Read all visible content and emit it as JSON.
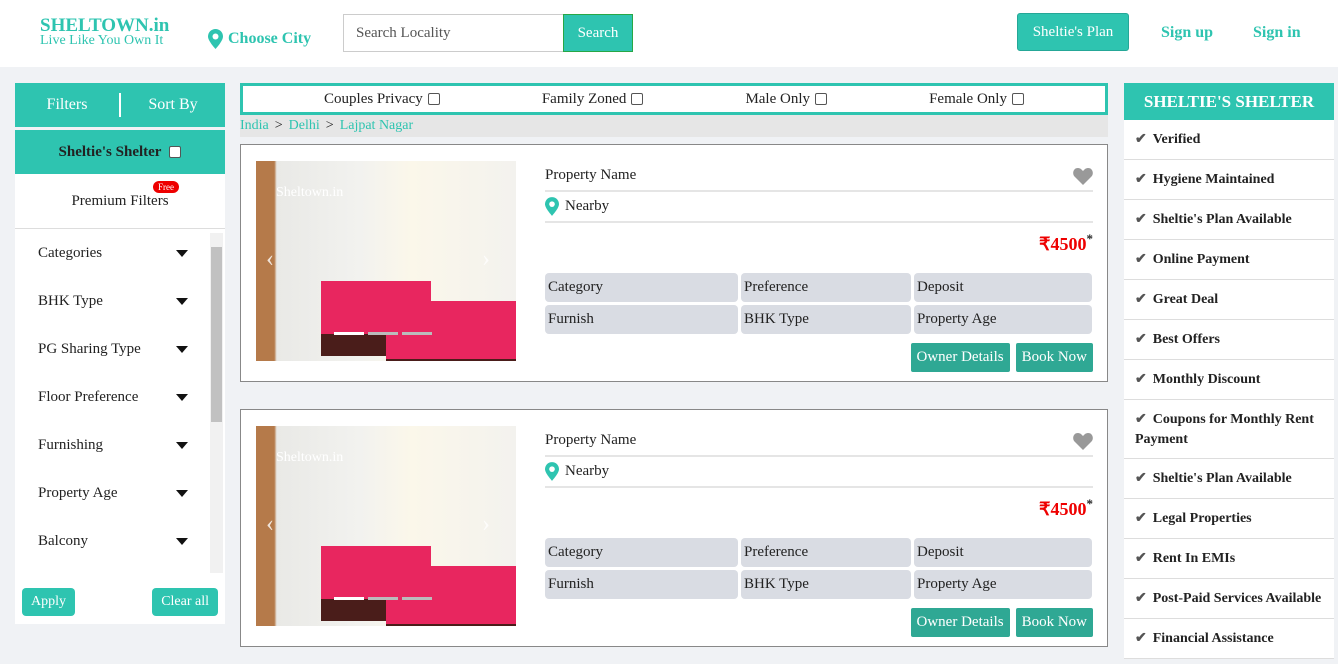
{
  "header": {
    "logo_title": "SHELTOWN.in",
    "logo_tagline": "Live Like You Own It",
    "city": "Choose City",
    "search_placeholder": "Search Locality",
    "search_button": "Search",
    "plan_button": "Sheltie's Plan",
    "sign_up": "Sign up",
    "sign_in": "Sign in"
  },
  "sidebar": {
    "tab_filters": "Filters",
    "tab_sort": "Sort By",
    "shelter": "Sheltie's Shelter",
    "premium": "Premium Filters",
    "free_badge": "Free",
    "filters": [
      "Categories",
      "BHK Type",
      "PG Sharing Type",
      "Floor Preference",
      "Furnishing",
      "Property Age",
      "Balcony"
    ],
    "apply": "Apply",
    "clear": "Clear all"
  },
  "main": {
    "checks": [
      "Couples Privacy",
      "Family Zoned",
      "Male Only",
      "Female Only"
    ],
    "breadcrumb": [
      "India",
      "Delhi",
      "Lajpat Nagar"
    ],
    "cards": [
      {
        "watermark": "Sheltown.in",
        "name": "Property Name",
        "nearby": "Nearby",
        "price": "₹4500",
        "asterisk": "*",
        "attrs": [
          "Category",
          "Preference",
          "Deposit",
          "Furnish",
          "BHK Type",
          "Property Age"
        ],
        "owner": "Owner Details",
        "book": "Book Now"
      },
      {
        "watermark": "Sheltown.in",
        "name": "Property Name",
        "nearby": "Nearby",
        "price": "₹4500",
        "asterisk": "*",
        "attrs": [
          "Category",
          "Preference",
          "Deposit",
          "Furnish",
          "BHK Type",
          "Property Age"
        ],
        "owner": "Owner Details",
        "book": "Book Now"
      }
    ]
  },
  "right": {
    "title": "SHELTIE'S SHELTER",
    "items": [
      "Verified",
      "Hygiene Maintained",
      "Sheltie's Plan Available",
      "Online Payment",
      "Great Deal",
      "Best Offers",
      "Monthly Discount",
      "Coupons for Monthly Rent Payment",
      "Sheltie's Plan Available",
      "Legal Properties",
      "Rent In EMIs",
      "Post-Paid Services Available",
      "Financial Assistance"
    ]
  },
  "colors": {
    "accent": "#2ec4b0",
    "button": "#2fa894",
    "price": "#ee0000"
  }
}
